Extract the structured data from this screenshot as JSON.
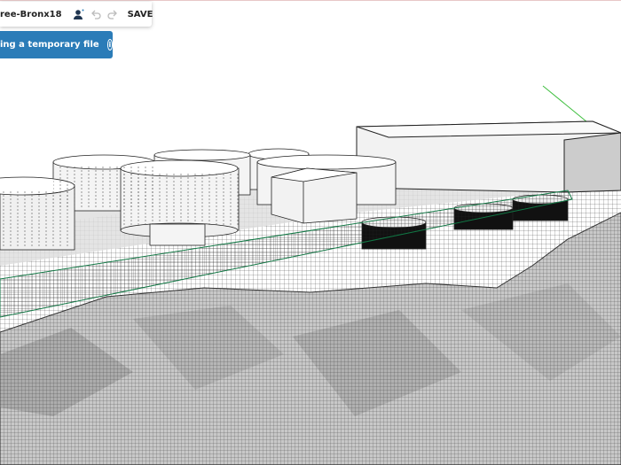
{
  "toolbar": {
    "file_name": "ree-Bronx18",
    "save_label": "SAVE",
    "icons": [
      "user-share-icon",
      "undo-icon",
      "redo-icon"
    ]
  },
  "banner": {
    "text": "ing a temporary file",
    "info_icon": "info-icon"
  },
  "colors": {
    "banner": "#2b7cb8",
    "axis_green": "#3fbf3f"
  }
}
